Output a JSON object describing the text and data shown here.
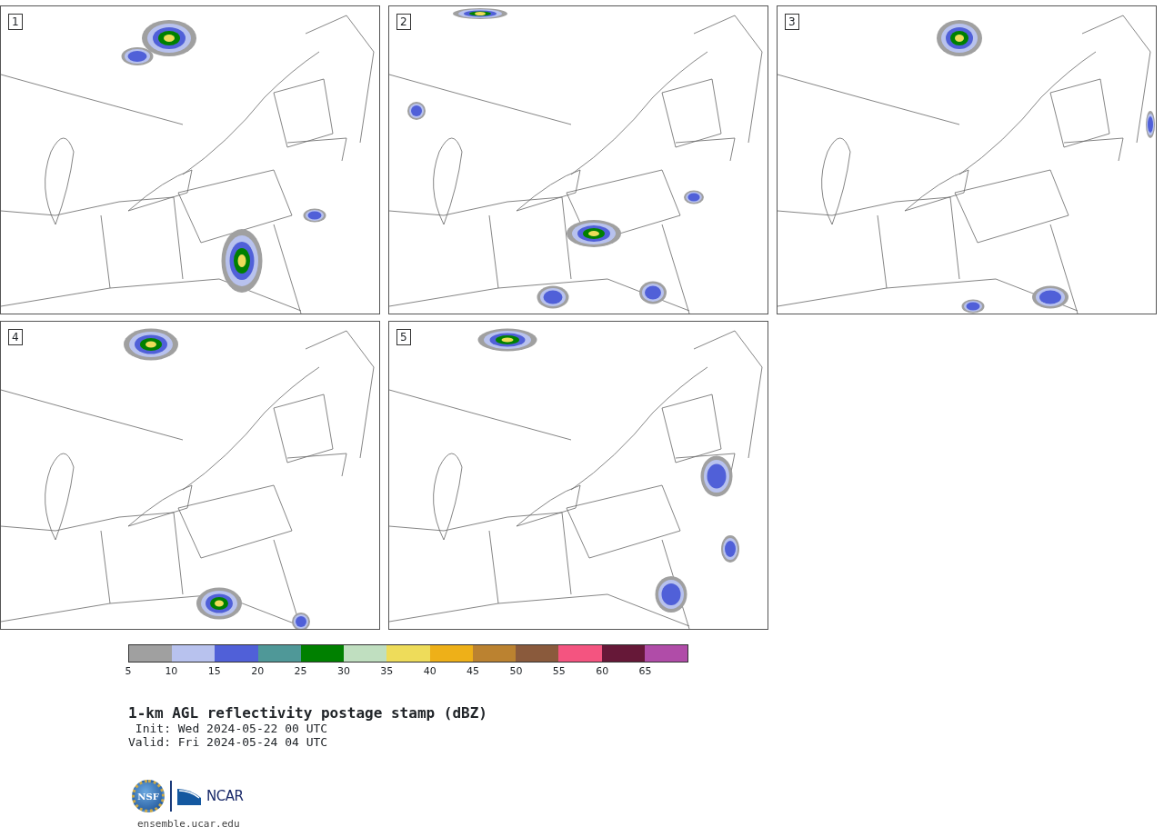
{
  "panels": [
    {
      "label": "1"
    },
    {
      "label": "2"
    },
    {
      "label": "3"
    },
    {
      "label": "4"
    },
    {
      "label": "5"
    }
  ],
  "colorbar": {
    "bins": [
      {
        "color": "#a0a0a0"
      },
      {
        "color": "#b8c2ee"
      },
      {
        "color": "#5060d8"
      },
      {
        "color": "#4f9898"
      },
      {
        "color": "#008000"
      },
      {
        "color": "#c0dfc0"
      },
      {
        "color": "#eedc5a"
      },
      {
        "color": "#eeb018"
      },
      {
        "color": "#bb8230"
      },
      {
        "color": "#8a5a3c"
      },
      {
        "color": "#f45480"
      },
      {
        "color": "#661838"
      },
      {
        "color": "#b04ca8"
      }
    ],
    "ticks": [
      "5",
      "10",
      "15",
      "20",
      "25",
      "30",
      "35",
      "40",
      "45",
      "50",
      "55",
      "60",
      "65"
    ]
  },
  "title": "1-km AGL reflectivity postage stamp (dBZ)",
  "init": " Init: Wed 2024-05-22 00 UTC",
  "valid": "Valid: Fri 2024-05-24 04 UTC",
  "logo": {
    "nsf_text": "NSF",
    "ncar_text": "NCAR"
  },
  "url": "ensemble.ucar.edu"
}
